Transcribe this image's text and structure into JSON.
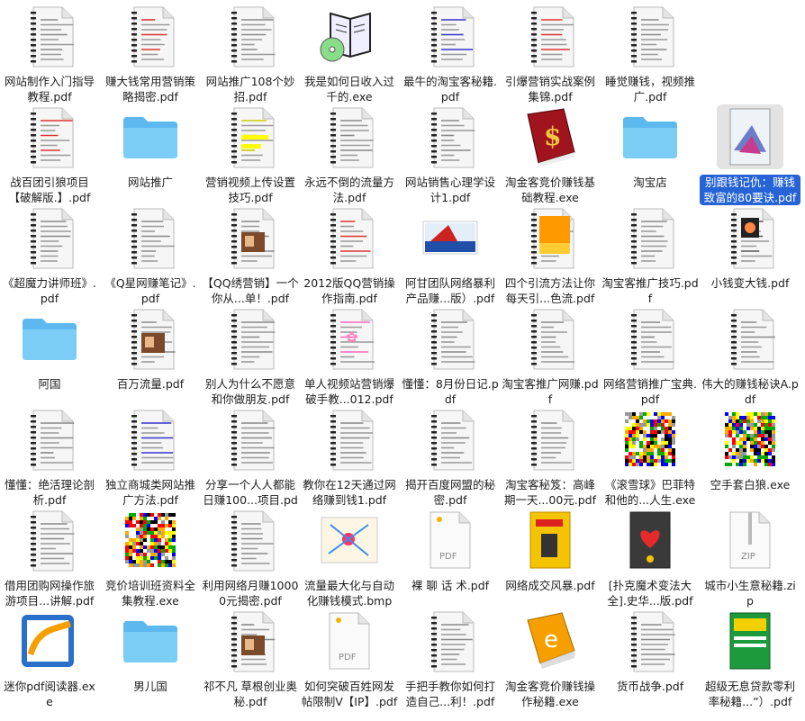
{
  "window": {
    "background": "#ffffff",
    "selected_color": "#2563d6"
  },
  "items": [
    {
      "label": "网站制作入门指导教程.pdf",
      "icon": "pdf-document-icon",
      "kind": "doc",
      "variant": "list"
    },
    {
      "label": "赚大钱常用营销策略揭密.pdf",
      "icon": "pdf-document-icon",
      "kind": "doc",
      "variant": "red"
    },
    {
      "label": "网站推广108个妙招.pdf",
      "icon": "pdf-document-icon",
      "kind": "doc",
      "variant": "list"
    },
    {
      "label": "我是如何日收入过千的.exe",
      "icon": "book-cd-icon",
      "kind": "bookcd"
    },
    {
      "label": "最牛的淘宝客秘籍.pdf",
      "icon": "pdf-document-icon",
      "kind": "doc",
      "variant": "blue"
    },
    {
      "label": "引爆营销实战案例集锦.pdf",
      "icon": "pdf-document-icon",
      "kind": "doc",
      "variant": "red"
    },
    {
      "label": "睡觉赚钱，视频推广.pdf",
      "icon": "pdf-document-icon",
      "kind": "doc",
      "variant": "list"
    },
    {
      "label": "",
      "icon": "",
      "kind": "empty"
    },
    {
      "label": "战百团引狼项目【破解版.】.pdf",
      "icon": "pdf-document-icon",
      "kind": "doc",
      "variant": "red"
    },
    {
      "label": "网站推广",
      "icon": "folder-icon",
      "kind": "folder"
    },
    {
      "label": "营销视频上传设置技巧.pdf",
      "icon": "pdf-document-icon",
      "kind": "doc",
      "variant": "yellow"
    },
    {
      "label": "永远不倒的流量方法.pdf",
      "icon": "pdf-document-icon",
      "kind": "doc",
      "variant": "list"
    },
    {
      "label": "网站销售心理学设计1.pdf",
      "icon": "pdf-document-icon",
      "kind": "doc",
      "variant": "list"
    },
    {
      "label": "淘金客竞价赚钱基础教程.exe",
      "icon": "dollar-book-icon",
      "kind": "dollarbook"
    },
    {
      "label": "淘宝店",
      "icon": "folder-icon",
      "kind": "folder"
    },
    {
      "label": "别跟钱记仇：赚钱致富的80要诀.pdf",
      "icon": "book-cover-icon",
      "kind": "cover",
      "selected": true
    },
    {
      "label": "《超魔力讲师班》.pdf",
      "icon": "pdf-document-icon",
      "kind": "doc",
      "variant": "list"
    },
    {
      "label": "《Q星网赚笔记》.pdf",
      "icon": "pdf-document-icon",
      "kind": "doc",
      "variant": "list"
    },
    {
      "label": "【QQ绣营销】一个你从...单！.pdf",
      "icon": "pdf-document-icon",
      "kind": "doc",
      "variant": "photo"
    },
    {
      "label": "2012版QQ营销操作指南.pdf",
      "icon": "pdf-document-icon",
      "kind": "doc",
      "variant": "red"
    },
    {
      "label": "阿甘团队网络暴利产品赚...版）.pdf",
      "icon": "banner-image-icon",
      "kind": "banner"
    },
    {
      "label": "四个引流方法让你每天引...色流.pdf",
      "icon": "pdf-document-icon",
      "kind": "doc",
      "variant": "orange"
    },
    {
      "label": "淘宝客推广技巧.pdf",
      "icon": "pdf-document-icon",
      "kind": "doc",
      "variant": "list"
    },
    {
      "label": "小钱变大钱.pdf",
      "icon": "pdf-document-icon",
      "kind": "doc",
      "variant": "dark"
    },
    {
      "label": "阿国",
      "icon": "folder-icon",
      "kind": "folder"
    },
    {
      "label": "百万流量.pdf",
      "icon": "pdf-document-icon",
      "kind": "doc",
      "variant": "photo"
    },
    {
      "label": "别人为什么不愿意和你做朋友.pdf",
      "icon": "pdf-document-icon",
      "kind": "doc",
      "variant": "list"
    },
    {
      "label": "单人视频站营销爆破手教...012.pdf",
      "icon": "pdf-document-icon",
      "kind": "doc",
      "variant": "pink"
    },
    {
      "label": "懂懂：8月份日记.pdf",
      "icon": "pdf-document-icon",
      "kind": "doc",
      "variant": "list"
    },
    {
      "label": "淘宝客推广网赚.pdf",
      "icon": "pdf-document-icon",
      "kind": "doc",
      "variant": "list"
    },
    {
      "label": "网络营销推广宝典.pdf",
      "icon": "pdf-document-icon",
      "kind": "doc",
      "variant": "list"
    },
    {
      "label": "伟大的赚钱秘诀A.pdf",
      "icon": "pdf-document-icon",
      "kind": "doc",
      "variant": "list"
    },
    {
      "label": "懂懂：绝活理论剖析.pdf",
      "icon": "pdf-document-icon",
      "kind": "doc",
      "variant": "list"
    },
    {
      "label": "独立商城类网站推广方法.pdf",
      "icon": "pdf-document-icon",
      "kind": "doc",
      "variant": "blue"
    },
    {
      "label": "分享一个人人都能日赚100...项目.pdf",
      "icon": "pdf-document-icon",
      "kind": "doc",
      "variant": "list"
    },
    {
      "label": "教你在12天通过网络赚到钱1.pdf",
      "icon": "pdf-document-icon",
      "kind": "doc",
      "variant": "list"
    },
    {
      "label": "揭开百度网盟的秘密.pdf",
      "icon": "pdf-document-icon",
      "kind": "doc",
      "variant": "list"
    },
    {
      "label": "淘宝客秘笈：高峰期一天...00元.pdf",
      "icon": "pdf-document-icon",
      "kind": "doc",
      "variant": "list"
    },
    {
      "label": "《滚雪球》巴菲特和他的...人生.exe",
      "icon": "noise-image-icon",
      "kind": "noise"
    },
    {
      "label": "空手套白狼.exe",
      "icon": "noise-image-icon",
      "kind": "noise"
    },
    {
      "label": "借用团购网操作旅游项目...讲解.pdf",
      "icon": "pdf-document-icon",
      "kind": "doc",
      "variant": "list"
    },
    {
      "label": "竞价培训班资料全集教程.exe",
      "icon": "noise-image-icon",
      "kind": "noise"
    },
    {
      "label": "利用网络月赚10000元揭密.pdf",
      "icon": "pdf-document-icon",
      "kind": "doc",
      "variant": "list"
    },
    {
      "label": "流量最大化与自动化赚钱模式.bmp",
      "icon": "mindmap-image-icon",
      "kind": "mindmap"
    },
    {
      "label": "裸 聊 话 术.pdf",
      "icon": "pdf-generic-icon",
      "kind": "pdfgeneric"
    },
    {
      "label": "网络成交风暴.pdf",
      "icon": "book-cover-icon",
      "kind": "yellowbook"
    },
    {
      "label": "[扑克魔术变法大全].史华...版.pdf",
      "icon": "book-cover-icon",
      "kind": "poker"
    },
    {
      "label": "城市小生意秘籍.zip",
      "icon": "zip-archive-icon",
      "kind": "zip"
    },
    {
      "label": "迷你pdf阅读器.exe",
      "icon": "app-icon",
      "kind": "app"
    },
    {
      "label": "男儿国",
      "icon": "folder-icon",
      "kind": "folder"
    },
    {
      "label": "祁不凡 草根创业奥秘.pdf",
      "icon": "pdf-document-icon",
      "kind": "doc",
      "variant": "photo"
    },
    {
      "label": "如何突破百姓网发帖限制V【IP】.pdf",
      "icon": "pdf-generic-icon",
      "kind": "pdfgeneric"
    },
    {
      "label": "手把手教你如何打造自己...利！.pdf",
      "icon": "pdf-document-icon",
      "kind": "doc",
      "variant": "list"
    },
    {
      "label": "淘金客竞价赚钱操作秘籍.exe",
      "icon": "ebook-orange-icon",
      "kind": "ebook"
    },
    {
      "label": "货币战争.pdf",
      "icon": "pdf-document-icon",
      "kind": "doc",
      "variant": "list"
    },
    {
      "label": "超级无息贷款零利率秘籍...”）.pdf",
      "icon": "book-cover-icon",
      "kind": "greenbook"
    }
  ],
  "glyphs": {
    "pdf_badge": "PDF",
    "zip_badge": "ZIP",
    "dollar": "$",
    "ebook_letter": "e"
  }
}
